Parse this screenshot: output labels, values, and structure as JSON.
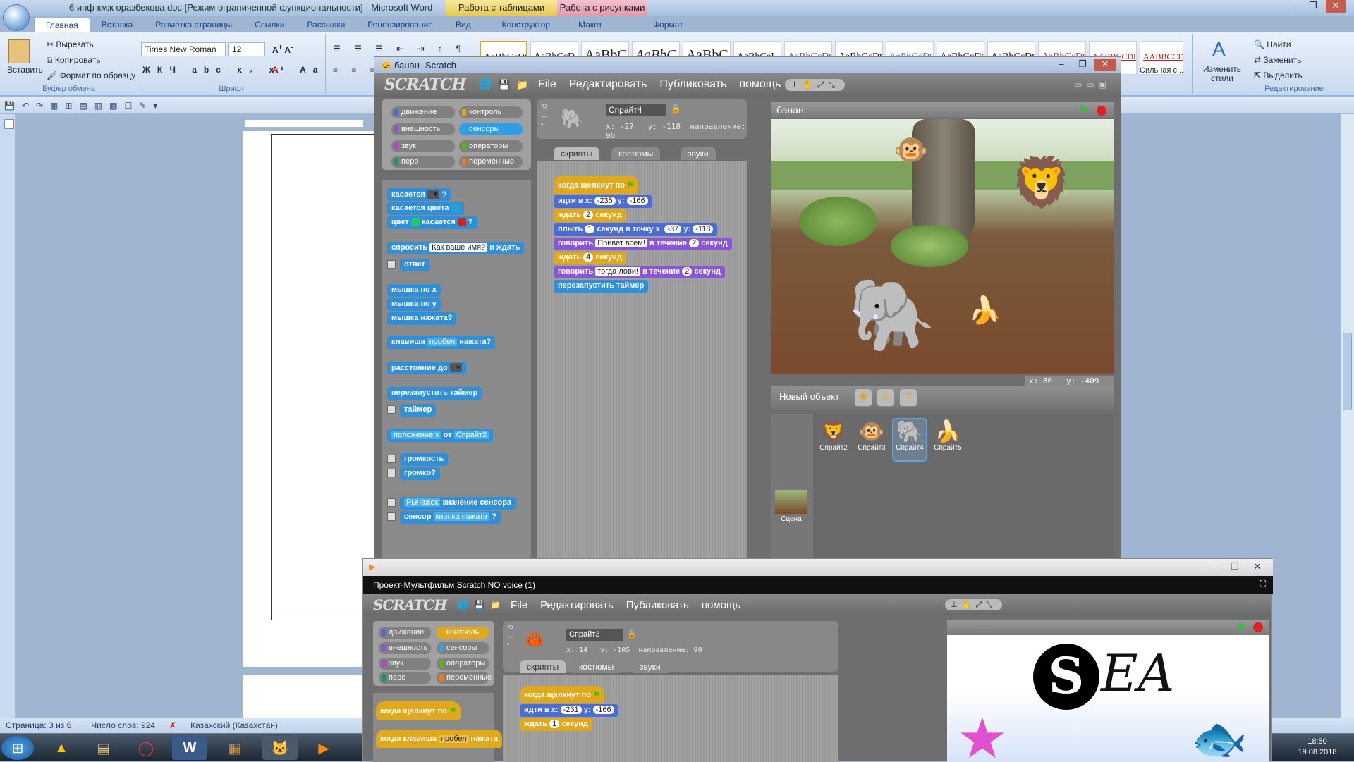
{
  "word": {
    "title": "6 инф кмж оразбекова.doc [Режим ограниченной функциональности] - Microsoft Word",
    "context_tab_tables": "Работа с таблицами",
    "context_tab_pictures": "Работа с рисунками",
    "tabs": [
      "Главная",
      "Вставка",
      "Разметка страницы",
      "Ссылки",
      "Рассылки",
      "Рецензирование",
      "Вид",
      "Конструктор",
      "Макет",
      "Формат"
    ],
    "clipboard": {
      "paste": "Вставить",
      "cut": "Вырезать",
      "copy": "Копировать",
      "format_painter": "Формат по образцу",
      "label": "Буфер обмена"
    },
    "font": {
      "name": "Times New Roman",
      "size": "12",
      "label": "Шрифт"
    },
    "styles": [
      "АаВbСcDt",
      "АаВbСcD",
      "АаВbС",
      "АаВbС",
      "АаВbС",
      "АаВbСеI",
      "АаВbСcDt",
      "АаВbСcDt",
      "АаВbСcDt",
      "АаВbСcDt",
      "АаВbСcDt",
      "АаВbСcDt",
      "AАВВССDD",
      "AАВВССDD"
    ],
    "style_last": "Сильная с...",
    "change_styles": "Изменить стили",
    "editing": {
      "find": "Найти",
      "replace": "Заменить",
      "select": "Выделить",
      "label": "Редактирование"
    },
    "status": {
      "page": "Страница: 3 из 6",
      "words": "Число слов: 924",
      "lang": "Казахский (Казахстан)"
    }
  },
  "taskbar": {
    "time": "18:50",
    "date": "19.08.2018"
  },
  "scratch1": {
    "title": "банан- Scratch",
    "logo": "SCRATCH",
    "menu": [
      "File",
      "Редактировать",
      "Публиковать",
      "помощь"
    ],
    "categories": [
      {
        "label": "движение",
        "color": "#4a6cd4"
      },
      {
        "label": "контроль",
        "color": "#e1a91a"
      },
      {
        "label": "внешность",
        "color": "#8a55d7"
      },
      {
        "label": "сенсоры",
        "color": "#2ca5e2"
      },
      {
        "label": "звук",
        "color": "#bb42c3"
      },
      {
        "label": "операторы",
        "color": "#5cb712"
      },
      {
        "label": "перо",
        "color": "#0e9a6c"
      },
      {
        "label": "переменные",
        "color": "#ee7d16"
      }
    ],
    "palette": {
      "touching": "касается",
      "touching_color": "касается цвета",
      "color": "цвет",
      "touches": "касается",
      "q": "?",
      "ask": "спросить",
      "ask_default": "Как ваше имя?",
      "and_wait": "и ждать",
      "answer": "ответ",
      "mouse_x": "мышка по x",
      "mouse_y": "мышка по y",
      "mouse_down": "мышка нажата?",
      "key": "клавиша",
      "key_val": "пробел",
      "pressed": "нажата?",
      "distance": "расстояние до",
      "reset_timer": "перезапустить таймер",
      "timer": "таймер",
      "position": "положение x",
      "of": "от",
      "of_sprite": "Спрайт2",
      "loudness": "громкость",
      "loud": "громко?",
      "slider": "Рычажок",
      "sensor_value": "значение сенсора",
      "sensor": "сенсор",
      "button_pressed": "кнопка нажата"
    },
    "sprite": {
      "name": "Спрайт4",
      "x": "x: -27",
      "y": "y: -118",
      "direction": "направление: 90"
    },
    "tabs": [
      "скрипты",
      "костюмы",
      "звуки"
    ],
    "script": {
      "hat": "когда щелкнут по",
      "goto": "идти в x:",
      "gx": "-235",
      "gy": "-166",
      "y": "y:",
      "wait": "ждать",
      "w1": "2",
      "sec": "секунд",
      "glide": "плыть",
      "g1": "1",
      "glide_to": "секунд в точку x:",
      "glx": "-37",
      "gly": "-118",
      "say": "говорить",
      "say1": "Привет всем!",
      "for": "в течение",
      "s1": "2",
      "w2": "4",
      "say2": "тогда лови!",
      "s2": "2",
      "reset": "перезапустить таймер"
    },
    "stage_name": "банан",
    "coords": {
      "x": "x: 80",
      "y": "y: -409"
    },
    "new_object": "Новый объект",
    "sprites": [
      "Спрайт2",
      "Спрайт3",
      "Спрайт4",
      "Спрайт5"
    ],
    "stage_label": "Сцена"
  },
  "scratch2": {
    "title": "Проект-Мультфильм Scratch NO voice (1)",
    "logo": "SCRATCH",
    "menu": [
      "File",
      "Редактировать",
      "Публиковать",
      "помощь"
    ],
    "categories": [
      {
        "label": "движение",
        "color": "#4a6cd4"
      },
      {
        "label": "контроль",
        "color": "#e1a91a"
      },
      {
        "label": "внешность",
        "color": "#8a55d7"
      },
      {
        "label": "сенсоры",
        "color": "#2ca5e2"
      },
      {
        "label": "звук",
        "color": "#bb42c3"
      },
      {
        "label": "операторы",
        "color": "#5cb712"
      },
      {
        "label": "перо",
        "color": "#0e9a6c"
      },
      {
        "label": "переменные",
        "color": "#ee7d16"
      }
    ],
    "palette": {
      "hat": "когда щелкнут по",
      "key_hat": "когда клавиша",
      "key_val": "пробел",
      "pressed": "нажата"
    },
    "sprite": {
      "name": "Спрайт3",
      "x": "x: 14",
      "y": "y: -105",
      "direction": "направление: 90"
    },
    "tabs": [
      "скрипты",
      "костюмы",
      "звуки"
    ],
    "script": {
      "hat": "когда щелкнут по",
      "goto": "идти в x:",
      "gx": "-231",
      "y": "y:",
      "gy": "-166",
      "wait": "ждать",
      "w1": "1",
      "sec": "секунд"
    },
    "stage_text": "ЕA"
  }
}
